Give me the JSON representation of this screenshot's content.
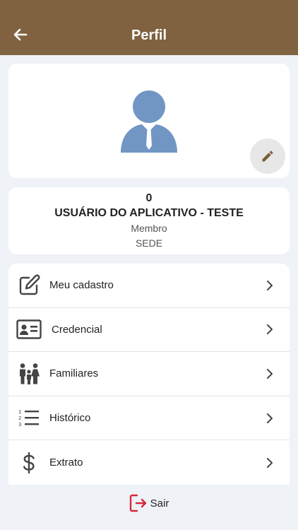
{
  "header": {
    "title": "Perfil",
    "back_icon": "arrow-left-icon",
    "color": "#806240"
  },
  "profile": {
    "avatar_icon": "user-avatar-icon",
    "avatar_color": "#7196c4",
    "edit_icon": "pencil-icon"
  },
  "info": {
    "id": "0",
    "name": "USUÁRIO DO APLICATIVO - TESTE",
    "role": "Membro",
    "unit": "SEDE"
  },
  "menu": {
    "items": [
      {
        "label": "Meu cadastro",
        "icon": "edit-square-icon"
      },
      {
        "label": "Credencial",
        "icon": "id-card-icon"
      },
      {
        "label": "Familiares",
        "icon": "family-icon"
      },
      {
        "label": "Histórico",
        "icon": "numbered-list-icon"
      },
      {
        "label": "Extrato",
        "icon": "dollar-icon"
      }
    ]
  },
  "logout": {
    "label": "Sair",
    "icon": "logout-icon",
    "color": "#d8283c"
  }
}
